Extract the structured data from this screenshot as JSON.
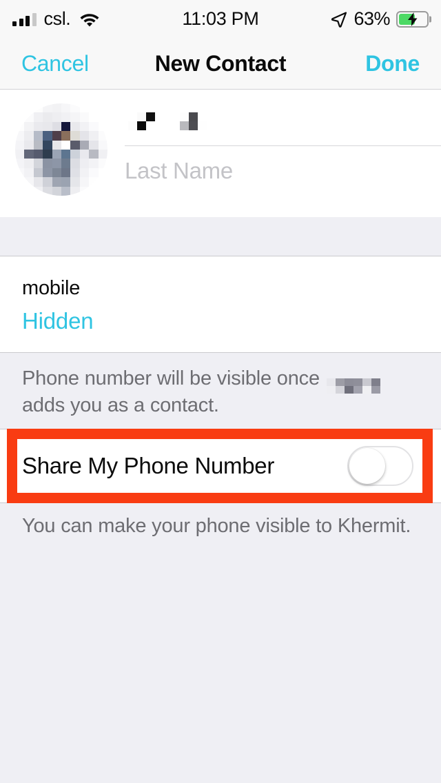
{
  "status_bar": {
    "carrier": "csl.",
    "time": "11:03 PM",
    "battery_percent": "63%",
    "battery_level": 60,
    "signal_bars_filled": 3,
    "signal_bars_total": 4,
    "wifi": "wifi-icon",
    "location": "location-arrow-icon",
    "charging": true
  },
  "nav_bar": {
    "cancel_label": "Cancel",
    "title": "New Contact",
    "done_label": "Done"
  },
  "name_section": {
    "avatar": "contact-photo-redacted",
    "first_name_value": "",
    "first_name_redacted": true,
    "last_name_placeholder": "Last Name",
    "last_name_value": ""
  },
  "phone_section": {
    "label": "mobile",
    "value": "Hidden"
  },
  "footer_note": {
    "text_before": "Phone number will be visible once",
    "redacted_name": true,
    "text_after": "adds you as a contact."
  },
  "toggle_row": {
    "label": "Share My Phone Number",
    "state": "off",
    "highlighted": true
  },
  "bottom_note": {
    "text": "You can make your phone visible to Khermit."
  },
  "colors": {
    "accent": "#2FC4E2",
    "annotation": "#F93C12",
    "group_background": "#EFEFF4",
    "row_background": "#FFFFFF",
    "bar_background": "#F8F8F8",
    "secondary_text": "#6D6D72",
    "placeholder_text": "#C3C3C7",
    "battery_green": "#4CD964"
  }
}
